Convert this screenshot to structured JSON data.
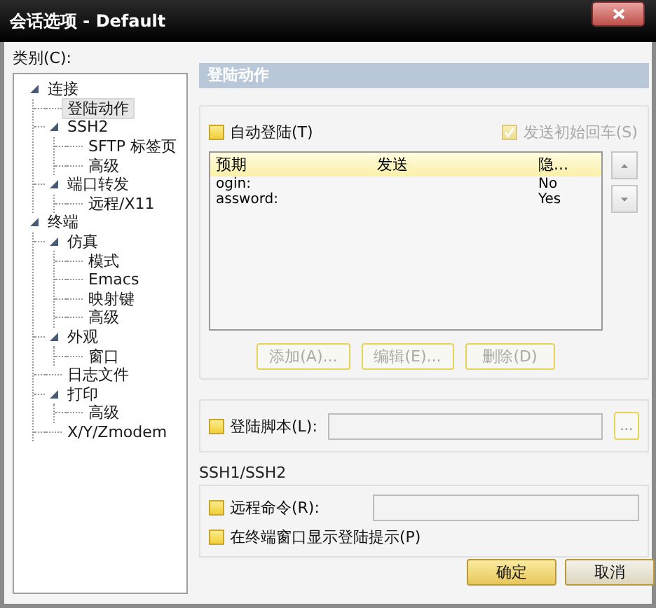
{
  "window": {
    "title": "会话选项 - Default"
  },
  "category_label": "类别(C):",
  "tree": [
    {
      "label": "连接",
      "expanded": true,
      "selected": false,
      "children": [
        {
          "label": "登陆动作",
          "selected": true
        },
        {
          "label": "SSH2",
          "expanded": true,
          "selected": false,
          "children": [
            {
              "label": "SFTP 标签页",
              "selected": false
            },
            {
              "label": "高级",
              "selected": false
            }
          ]
        },
        {
          "label": "端口转发",
          "expanded": true,
          "selected": false,
          "children": [
            {
              "label": "远程/X11",
              "selected": false
            }
          ]
        }
      ]
    },
    {
      "label": "终端",
      "expanded": true,
      "selected": false,
      "children": [
        {
          "label": "仿真",
          "expanded": true,
          "selected": false,
          "children": [
            {
              "label": "模式",
              "selected": false
            },
            {
              "label": "Emacs",
              "selected": false
            },
            {
              "label": "映射键",
              "selected": false
            },
            {
              "label": "高级",
              "selected": false
            }
          ]
        },
        {
          "label": "外观",
          "expanded": true,
          "selected": false,
          "children": [
            {
              "label": "窗口",
              "selected": false
            }
          ]
        },
        {
          "label": "日志文件",
          "selected": false
        },
        {
          "label": "打印",
          "expanded": true,
          "selected": false,
          "children": [
            {
              "label": "高级",
              "selected": false
            }
          ]
        },
        {
          "label": "X/Y/Zmodem",
          "selected": false
        }
      ]
    }
  ],
  "panel": {
    "title": "登陆动作",
    "auto_login": {
      "label": "自动登陆(T)",
      "checked": false,
      "disabled": false
    },
    "send_cr": {
      "label": "发送初始回车(S)",
      "checked": true,
      "disabled": true
    },
    "table": {
      "columns": [
        "预期",
        "发送",
        "隐..."
      ],
      "rows": [
        {
          "expect": "ogin:",
          "hide": "No"
        },
        {
          "expect": "assword:",
          "hide": "Yes"
        }
      ]
    },
    "buttons": [
      {
        "label": "添加(A)...",
        "disabled": true
      },
      {
        "label": "编辑(E)...",
        "disabled": true
      },
      {
        "label": "删除(D)",
        "disabled": true
      }
    ],
    "login_script": {
      "label": "登陆脚本(L):",
      "checked": false,
      "disabled": false,
      "browse": "..."
    },
    "ssh_group": {
      "title": "SSH1/SSH2",
      "remote_command": {
        "label": "远程命令(R):",
        "checked": false,
        "disabled": false
      },
      "show_prompt": {
        "label": "在终端窗口显示登陆提示(P)",
        "checked": false,
        "disabled": false
      }
    }
  },
  "dialog_buttons": [
    {
      "label": "确定",
      "default": true
    },
    {
      "label": "取消",
      "default": false
    }
  ]
}
